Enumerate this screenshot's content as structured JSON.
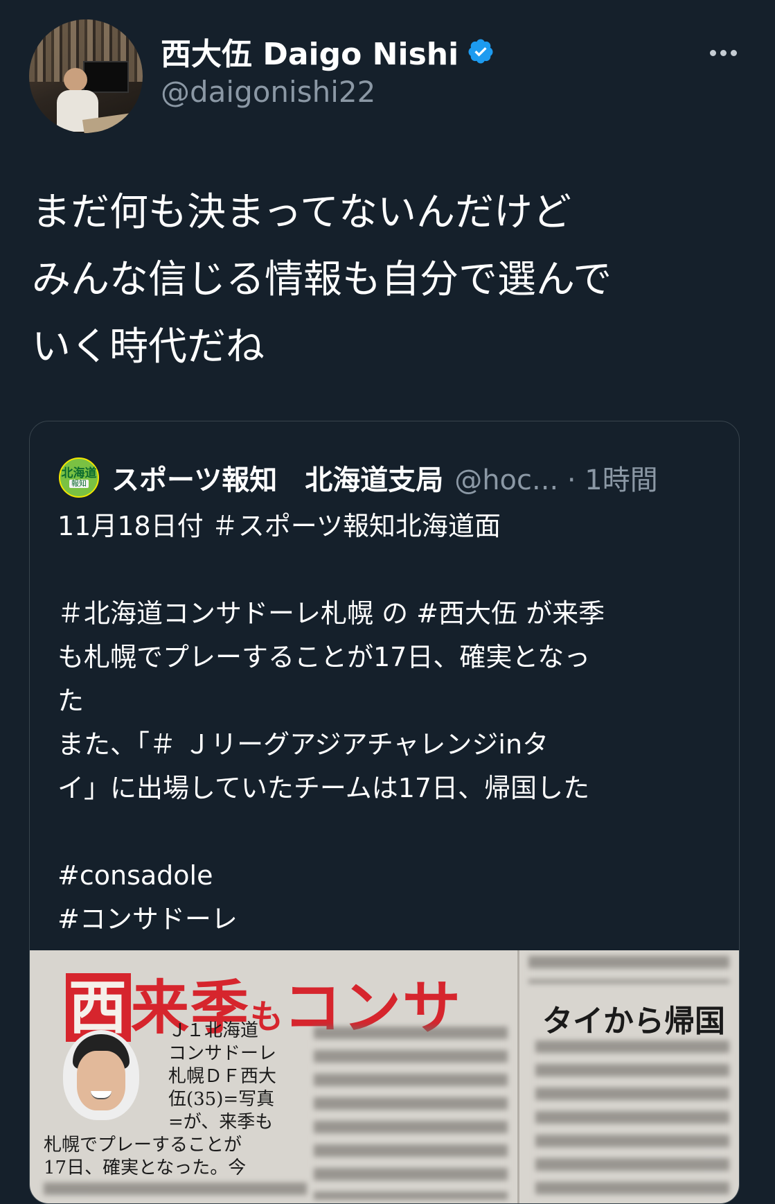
{
  "author": {
    "name": "西大伍 Daigo Nishi",
    "handle": "@daigonishi22"
  },
  "tweet": {
    "lines": [
      "まだ何も決まってないんだけど",
      "みんな信じる情報も自分で選んで",
      "いく時代だね"
    ]
  },
  "quote": {
    "logo_text": "北海道",
    "logo_sub": "報知",
    "name": "スポーツ報知　北海道支局",
    "handle_time": "@hoc... · 1時間",
    "lines": [
      "11月18日付 ＃スポーツ報知北海道面",
      "",
      " ＃北海道コンサドーレ札幌 の #西大伍 が来季",
      "も札幌でプレーすることが17日、確実となっ",
      "た",
      "また、「＃ Ｊリーグアジアチャレンジinタ",
      "イ」に出場していたチームは17日、帰国した",
      "",
      "#consadole",
      "#コンサドーレ"
    ]
  },
  "news_image": {
    "headline_first": "西",
    "headline_mid": "来季",
    "headline_small": "も",
    "headline_end": "コンサ",
    "side_title": "タイから帰国",
    "col1": [
      "Ｊ１北海道",
      "コンサドーレ",
      "札幌ＤＦ西大",
      "伍(35)=写真"
    ],
    "col2": [
      "=が、来季も",
      "札幌でプレーすることが",
      "17日、確実となった。今"
    ]
  },
  "colors": {
    "background": "#15202b",
    "secondary_text": "#8b98a5",
    "verified": "#1d9bf0",
    "headline_red": "#d6252d"
  },
  "icons": [
    "verified-badge-icon",
    "more-options-icon"
  ]
}
